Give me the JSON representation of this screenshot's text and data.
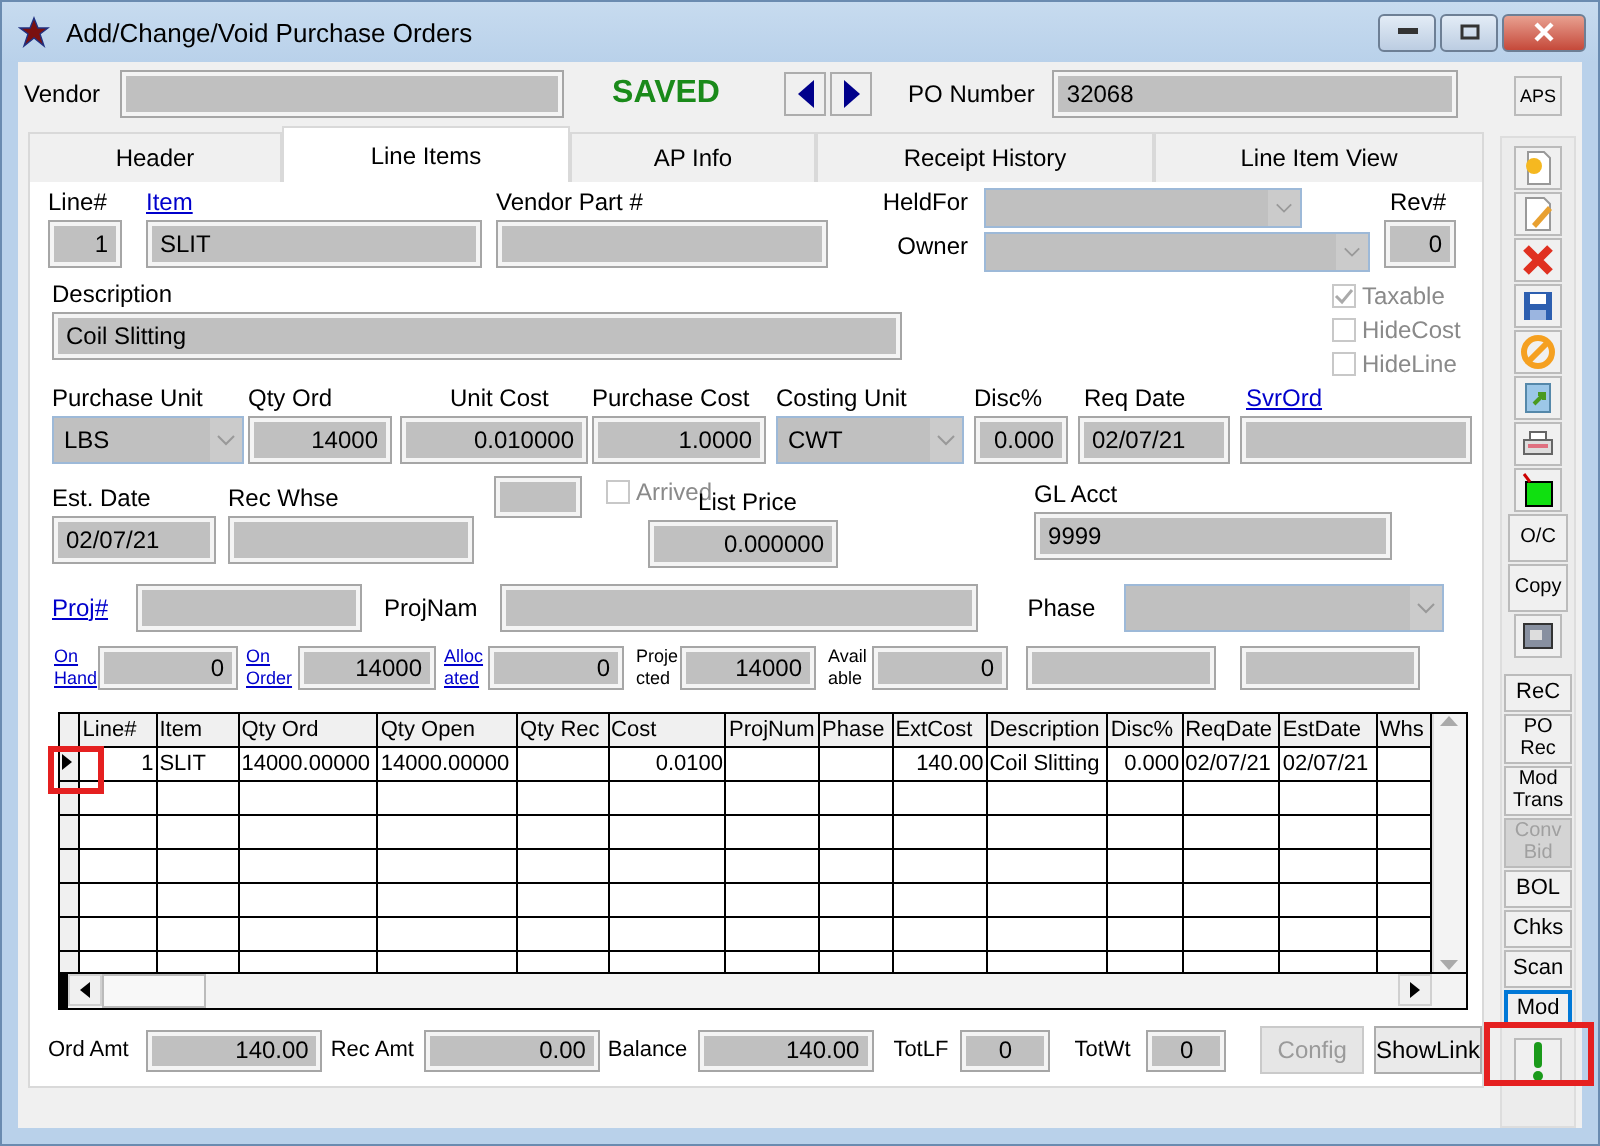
{
  "window": {
    "title": "Add/Change/Void Purchase Orders"
  },
  "top": {
    "vendor_label": "Vendor",
    "status": "SAVED",
    "po_label": "PO Number",
    "po_value": "32068",
    "aps": "APS"
  },
  "tabs": [
    {
      "label": "Header",
      "selected": false
    },
    {
      "label": "Line Items",
      "selected": true
    },
    {
      "label": "AP Info",
      "selected": false
    },
    {
      "label": "Receipt History",
      "selected": false
    },
    {
      "label": "Line Item View",
      "selected": false
    }
  ],
  "line_items": {
    "line_no": {
      "label": "Line#",
      "value": "1"
    },
    "item": {
      "label": "Item",
      "value": "SLIT"
    },
    "vendor_part": {
      "label": "Vendor Part #"
    },
    "held_for": {
      "label": "HeldFor"
    },
    "owner": {
      "label": "Owner"
    },
    "rev": {
      "label": "Rev#",
      "value": "0"
    },
    "options": [
      {
        "label": "Taxable",
        "checked": true
      },
      {
        "label": "HideCost",
        "checked": false
      },
      {
        "label": "HideLine",
        "checked": false
      }
    ],
    "description": {
      "label": "Description",
      "value": "Coil Slitting"
    },
    "purchase_unit": {
      "label": "Purchase Unit",
      "value": "LBS"
    },
    "qty_ord": {
      "label": "Qty Ord",
      "value": "14000"
    },
    "unit_cost": {
      "label": "Unit Cost",
      "value": "0.010000"
    },
    "purchase_cost": {
      "label": "Purchase Cost",
      "value": "1.0000"
    },
    "costing_unit": {
      "label": "Costing Unit",
      "value": "CWT"
    },
    "disc": {
      "label": "Disc%",
      "value": "0.000"
    },
    "req_date": {
      "label": "Req Date",
      "value": "02/07/21"
    },
    "svr_ord": {
      "label": "SvrOrd"
    },
    "est_date": {
      "label": "Est. Date",
      "value": "02/07/21"
    },
    "rec_whse": {
      "label": "Rec Whse"
    },
    "arrived": {
      "label": "Arrived",
      "checked": false
    },
    "list_price": {
      "label": "List Price",
      "value": "0.000000"
    },
    "gl_acct": {
      "label": "GL Acct",
      "value": "9999"
    },
    "proj": {
      "label": "Proj#"
    },
    "proj_name": {
      "label": "ProjNam"
    },
    "phase": {
      "label": "Phase"
    },
    "quantities": [
      {
        "label": "On Hand",
        "kind": "link",
        "value": "0"
      },
      {
        "label": "On Order",
        "kind": "link",
        "value": "14000"
      },
      {
        "label": "Allocated",
        "kind": "link",
        "value": "0"
      },
      {
        "label": "Projected",
        "kind": "text",
        "value": "14000"
      },
      {
        "label": "Available",
        "kind": "text",
        "value": "0"
      }
    ]
  },
  "grid": {
    "columns": [
      "Line#",
      "Item",
      "Qty Ord",
      "Qty Open",
      "Qty Rec",
      "Cost",
      "ProjNum",
      "Phase",
      "ExtCost",
      "Description",
      "Disc%",
      "ReqDate",
      "EstDate",
      "Whs"
    ],
    "rows": [
      {
        "selected": true,
        "cells": [
          "1",
          "SLIT",
          "14000.00000",
          "14000.00000",
          "",
          "0.0100",
          "",
          "",
          "140.00",
          "Coil Slitting",
          "0.000",
          "02/07/21",
          "02/07/21",
          ""
        ]
      }
    ]
  },
  "totals": [
    {
      "label": "Ord Amt",
      "value": "140.00"
    },
    {
      "label": "Rec Amt",
      "value": "0.00"
    },
    {
      "label": "Balance",
      "value": "140.00"
    },
    {
      "label": "TotLF",
      "value": "0"
    },
    {
      "label": "TotWt",
      "value": "0"
    }
  ],
  "buttons": [
    {
      "label": "Config",
      "disabled": true
    },
    {
      "label": "ShowLink",
      "disabled": false
    }
  ],
  "sidebar_buttons": [
    {
      "label": "O/C"
    },
    {
      "label": "Copy"
    }
  ],
  "sidebar_commands": [
    {
      "label": "ReC",
      "disabled": false,
      "focused": false
    },
    {
      "label": "PO Rec",
      "disabled": false,
      "focused": false
    },
    {
      "label": "Mod Trans",
      "disabled": false,
      "focused": false
    },
    {
      "label": "Conv Bid",
      "disabled": true,
      "focused": false
    },
    {
      "label": "BOL",
      "disabled": false,
      "focused": false
    },
    {
      "label": "Chks",
      "disabled": false,
      "focused": false
    },
    {
      "label": "Scan",
      "disabled": false,
      "focused": false
    },
    {
      "label": "Mod",
      "disabled": false,
      "focused": true
    }
  ]
}
